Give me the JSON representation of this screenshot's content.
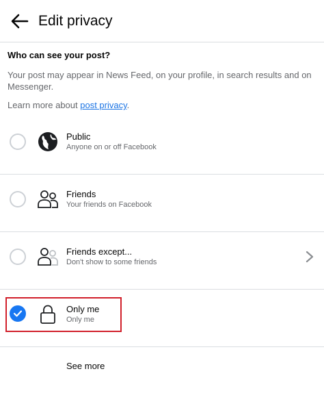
{
  "header": {
    "title": "Edit privacy"
  },
  "intro": {
    "heading": "Who can see your post?",
    "description": "Your post may appear in News Feed, on your profile, in search results and on Messenger.",
    "learn_more_prefix": "Learn more about ",
    "learn_more_link": "post privacy",
    "learn_more_suffix": "."
  },
  "options": [
    {
      "label": "Public",
      "sub": "Anyone on or off Facebook",
      "icon": "globe-icon",
      "selected": false
    },
    {
      "label": "Friends",
      "sub": "Your friends on Facebook",
      "icon": "friends-icon",
      "selected": false
    },
    {
      "label": "Friends except...",
      "sub": "Don't show to some friends",
      "icon": "friends-except-icon",
      "selected": false
    },
    {
      "label": "Only me",
      "sub": "Only me",
      "icon": "lock-icon",
      "selected": true
    }
  ],
  "footer": {
    "see_more": "See more"
  },
  "colors": {
    "accent": "#1877f2",
    "highlight": "#d11f2a",
    "link": "#1b74e4"
  }
}
